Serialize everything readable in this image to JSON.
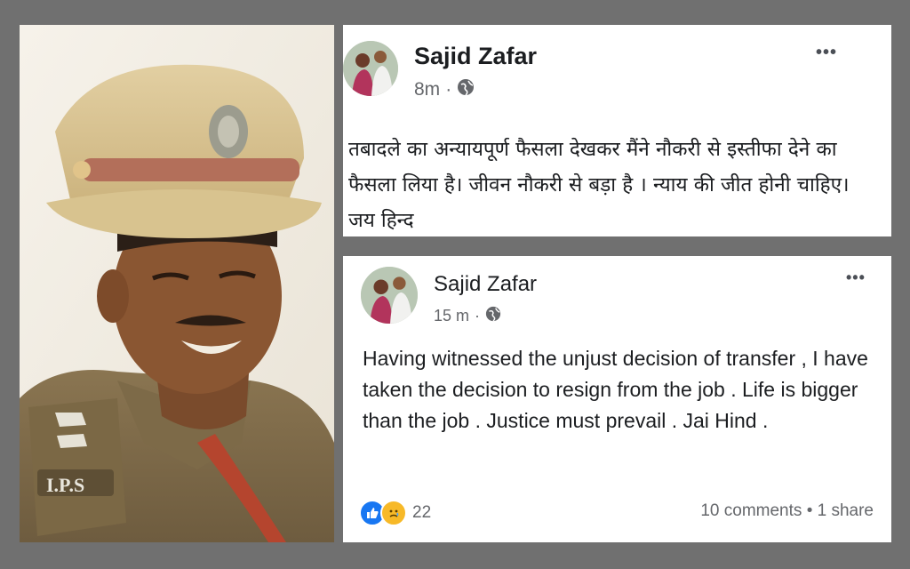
{
  "colors": {
    "background": "#707070",
    "card": "#ffffff",
    "text": "#1c1e21",
    "secondary_text": "#65676b",
    "like_blue": "#1877f2",
    "sad_yellow": "#f7b928"
  },
  "photo": {
    "badge_text": "I.P.S"
  },
  "posts": [
    {
      "author": "Sajid Zafar",
      "time": "8m",
      "separator": "·",
      "audience_icon": "globe-icon",
      "more_icon": "more-options-icon",
      "more_label": "•••",
      "text": "तबादले का अन्यायपूर्ण फैसला देखकर मैंने नौकरी से इस्तीफा देने का फैसला लिया है। जीवन नौकरी से बड़ा है । न्याय की जीत होनी चाहिए। जय हिन्द"
    },
    {
      "author": "Sajid Zafar",
      "time": "15 m",
      "separator": "·",
      "audience_icon": "globe-icon",
      "more_icon": "more-options-icon",
      "more_label": "•••",
      "text": "Having witnessed the unjust decision of transfer , I have taken the decision to resign from the job . Life is bigger than the job . Justice must prevail . Jai Hind .",
      "reactions": [
        "like-icon",
        "sad-icon"
      ],
      "reaction_count": "22",
      "comments": "10 comments",
      "bullet": "•",
      "shares": "1 share"
    }
  ]
}
